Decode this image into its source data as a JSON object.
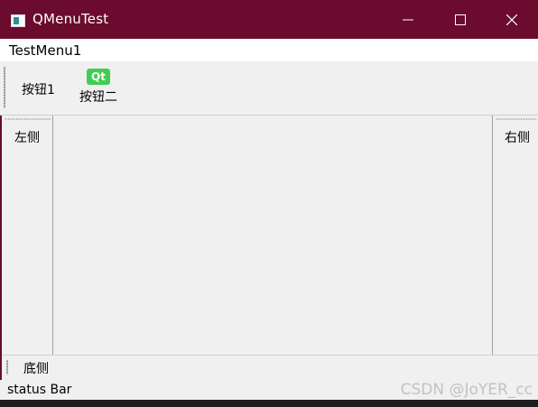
{
  "window": {
    "title": "QMenuTest",
    "title_color": "#6b0b2d",
    "icon": "app-window-icon",
    "controls": [
      "minimize-icon",
      "maximize-icon",
      "close-icon"
    ]
  },
  "menubar": {
    "items": [
      {
        "label": "TestMenu1"
      }
    ]
  },
  "toolbar": {
    "buttons": [
      {
        "label": "按钮1",
        "icon": null
      },
      {
        "label": "按钮二",
        "icon": "qt-logo-icon",
        "icon_text": "Qt",
        "icon_color": "#41cd52"
      }
    ]
  },
  "docks": {
    "left": {
      "label": "左侧"
    },
    "right": {
      "label": "右侧"
    },
    "bottom": {
      "label": "底侧"
    }
  },
  "statusbar": {
    "text": "status Bar",
    "watermark": "CSDN @JoYER_cc"
  }
}
